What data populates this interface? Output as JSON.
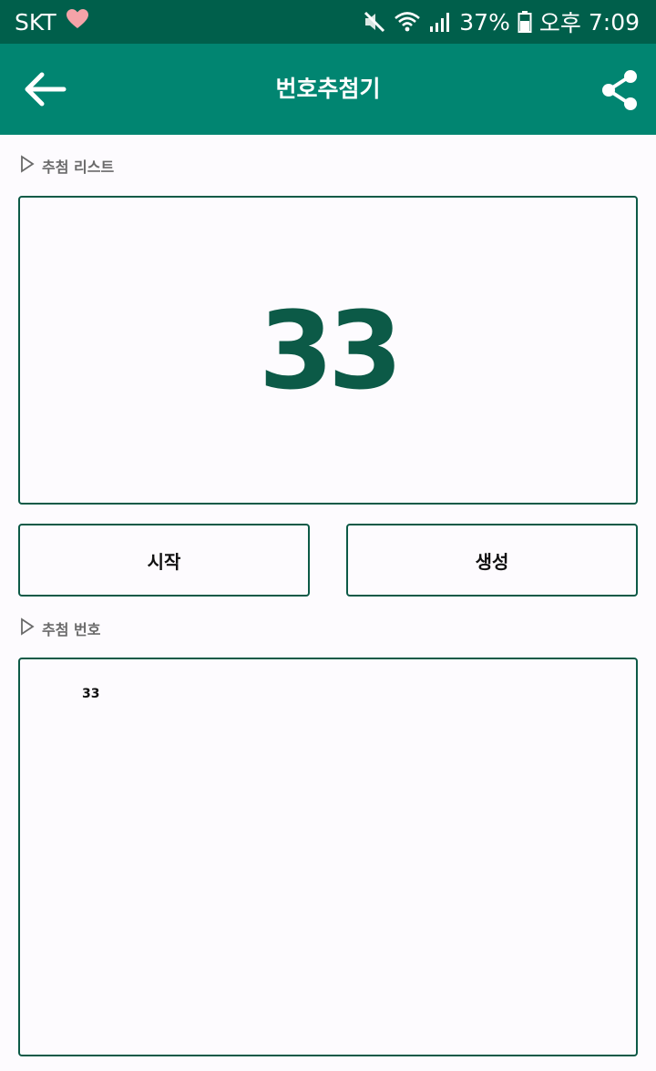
{
  "status_bar": {
    "carrier": "SKT",
    "battery": "37%",
    "ampm": "오후",
    "time": "7:09",
    "icons": [
      "heart-icon",
      "mute-icon",
      "wifi-icon",
      "signal-icon",
      "battery-icon"
    ]
  },
  "app_bar": {
    "title": "번호추첨기",
    "icons": [
      "back-arrow-icon",
      "share-icon"
    ]
  },
  "draw_list": {
    "label": "추첨 리스트",
    "current_number": "33"
  },
  "buttons": {
    "start_label": "시작",
    "generate_label": "생성"
  },
  "draw_numbers": {
    "label": "추첨 번호",
    "items": [
      "33"
    ]
  },
  "colors": {
    "status_bar": "#005f4b",
    "app_bar": "#018571",
    "accent": "#0c5a47",
    "background": "#fdfbfe"
  }
}
